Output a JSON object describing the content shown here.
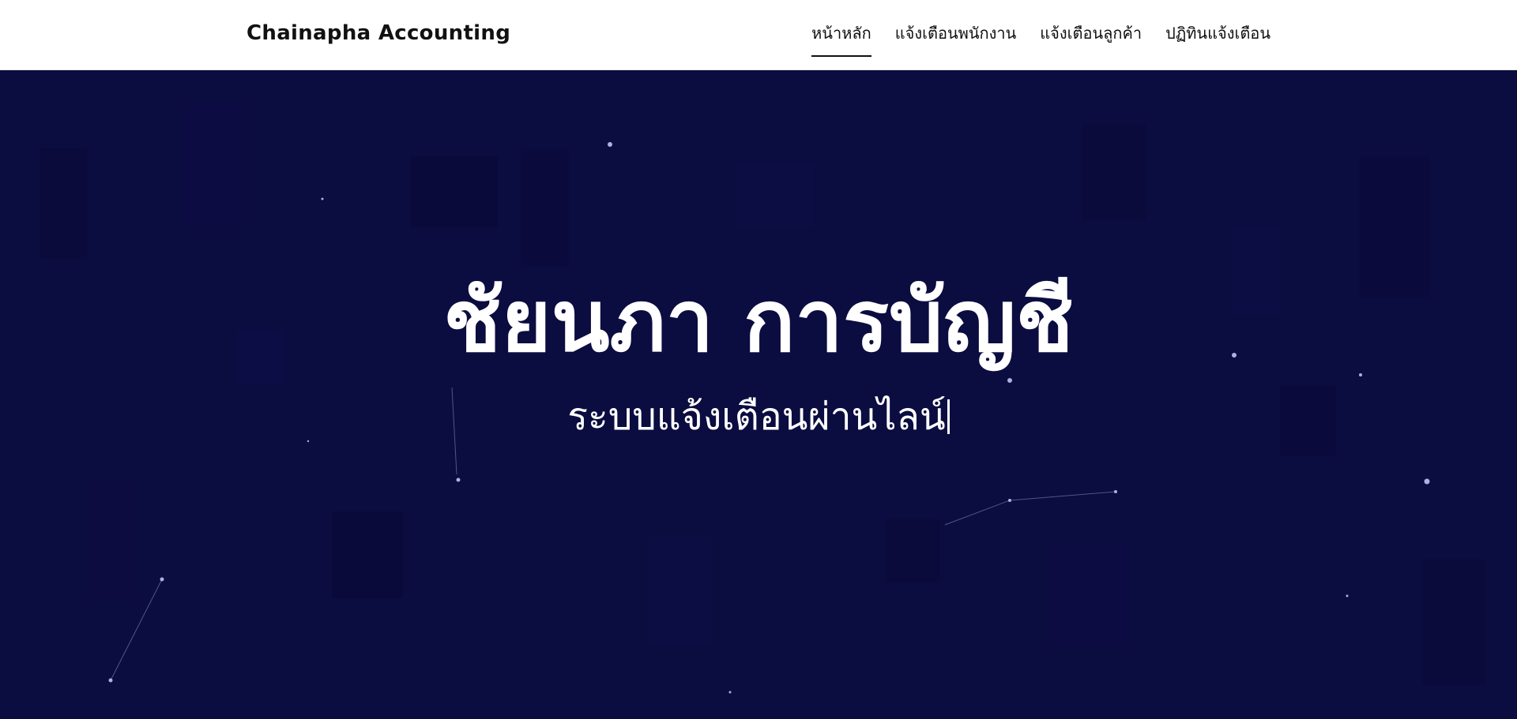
{
  "brand": {
    "name": "Chainapha Accounting"
  },
  "nav": {
    "items": [
      {
        "label": "หน้าหลัก",
        "active": true
      },
      {
        "label": "แจ้งเตือนพนักงาน",
        "active": false
      },
      {
        "label": "แจ้งเตือนลูกค้า",
        "active": false
      },
      {
        "label": "ปฏิทินแจ้งเตือน",
        "active": false
      }
    ]
  },
  "hero": {
    "title": "ชัยนภา การบัญชี",
    "subtitle": "ระบบแจ้งเตือนผ่านไลน์"
  },
  "colors": {
    "navbar_bg": "#ffffff",
    "hero_bg": "#0b0c40",
    "text_dark": "#111111",
    "text_light": "#ffffff"
  }
}
